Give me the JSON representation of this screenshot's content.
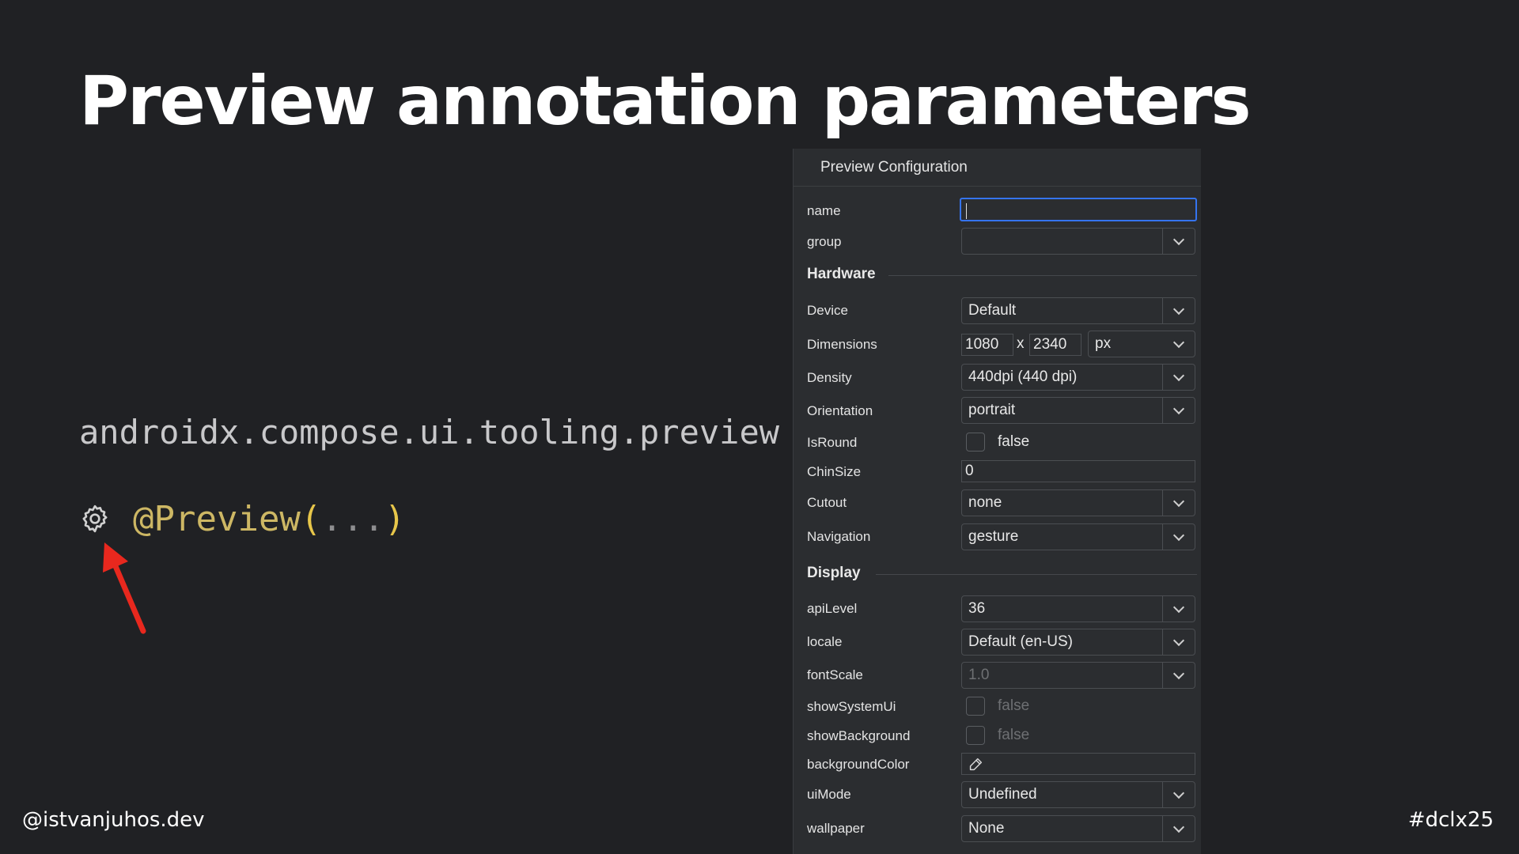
{
  "slide": {
    "title": "Preview annotation parameters",
    "package": "androidx.compose.ui.tooling.preview",
    "annotation_at": "@Preview",
    "annotation_open": "(",
    "annotation_dots": "...",
    "annotation_close": ")",
    "handle": "@istvanjuhos.dev",
    "hashtag": "#dclx25",
    "gear_icon": "gear-icon",
    "arrow_icon": "red-arrow-icon",
    "colors": {
      "background": "#202124",
      "arrow": "#e8281e",
      "annotation": "#cdb764",
      "accent": "#3574f0"
    }
  },
  "panel": {
    "header": "Preview Configuration",
    "name_label": "name",
    "name_value": "",
    "group_label": "group",
    "group_value": "",
    "hardware": {
      "title": "Hardware",
      "device_label": "Device",
      "device_value": "Default",
      "dimensions_label": "Dimensions",
      "width_value": "1080",
      "x_sep": "x",
      "height_value": "2340",
      "unit_value": "px",
      "density_label": "Density",
      "density_value": "440dpi (440 dpi)",
      "orientation_label": "Orientation",
      "orientation_value": "portrait",
      "isround_label": "IsRound",
      "isround_value": "false",
      "chinsize_label": "ChinSize",
      "chinsize_value": "0",
      "cutout_label": "Cutout",
      "cutout_value": "none",
      "navigation_label": "Navigation",
      "navigation_value": "gesture"
    },
    "display": {
      "title": "Display",
      "apilevel_label": "apiLevel",
      "apilevel_value": "36",
      "locale_label": "locale",
      "locale_value": "Default (en-US)",
      "fontscale_label": "fontScale",
      "fontscale_value": "1.0",
      "showsystemui_label": "showSystemUi",
      "showsystemui_value": "false",
      "showbackground_label": "showBackground",
      "showbackground_value": "false",
      "backgroundcolor_label": "backgroundColor",
      "backgroundcolor_value": "",
      "uimode_label": "uiMode",
      "uimode_value": "Undefined",
      "wallpaper_label": "wallpaper",
      "wallpaper_value": "None"
    }
  }
}
